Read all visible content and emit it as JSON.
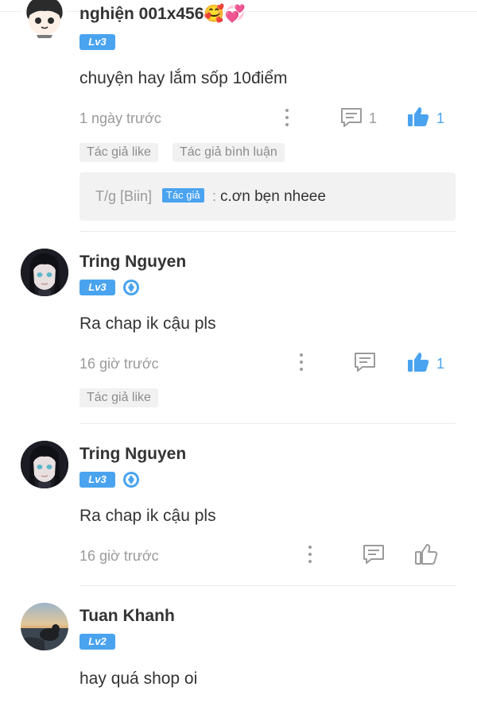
{
  "comments": [
    {
      "username": "nghiện 001x456🥰💞",
      "level": "Lv3",
      "text": "chuyện hay lắm sốp 10điểm",
      "time": "1 ngày trước",
      "reply_count": "1",
      "like_count": "1",
      "liked": true,
      "tags": [
        "Tác giả like",
        "Tác giả bình luận"
      ],
      "author_reply": {
        "author": "T/g [Biin]",
        "badge": "Tác giả",
        "separator": ":",
        "text": "c.ơn bẹn nheee"
      }
    },
    {
      "username": "Tring Nguyen",
      "level": "Lv3",
      "text": "Ra chap ik cậu pls",
      "time": "16 giờ trước",
      "like_count": "1",
      "liked": true,
      "tags": [
        "Tác giả like"
      ]
    },
    {
      "username": "Tring Nguyen",
      "level": "Lv3",
      "text": "Ra chap ik cậu pls",
      "time": "16 giờ trước",
      "liked": false
    },
    {
      "username": "Tuan Khanh",
      "level": "Lv2",
      "text": "hay quá shop oi"
    }
  ],
  "colors": {
    "accent": "#4aa3ef",
    "muted": "#9a9a9a",
    "tag_bg": "#f1f1f1"
  },
  "icons": {
    "more": "vertical-dots-icon",
    "reply": "comment-icon",
    "like": "thumbs-up-icon",
    "medal": "medal-icon"
  }
}
